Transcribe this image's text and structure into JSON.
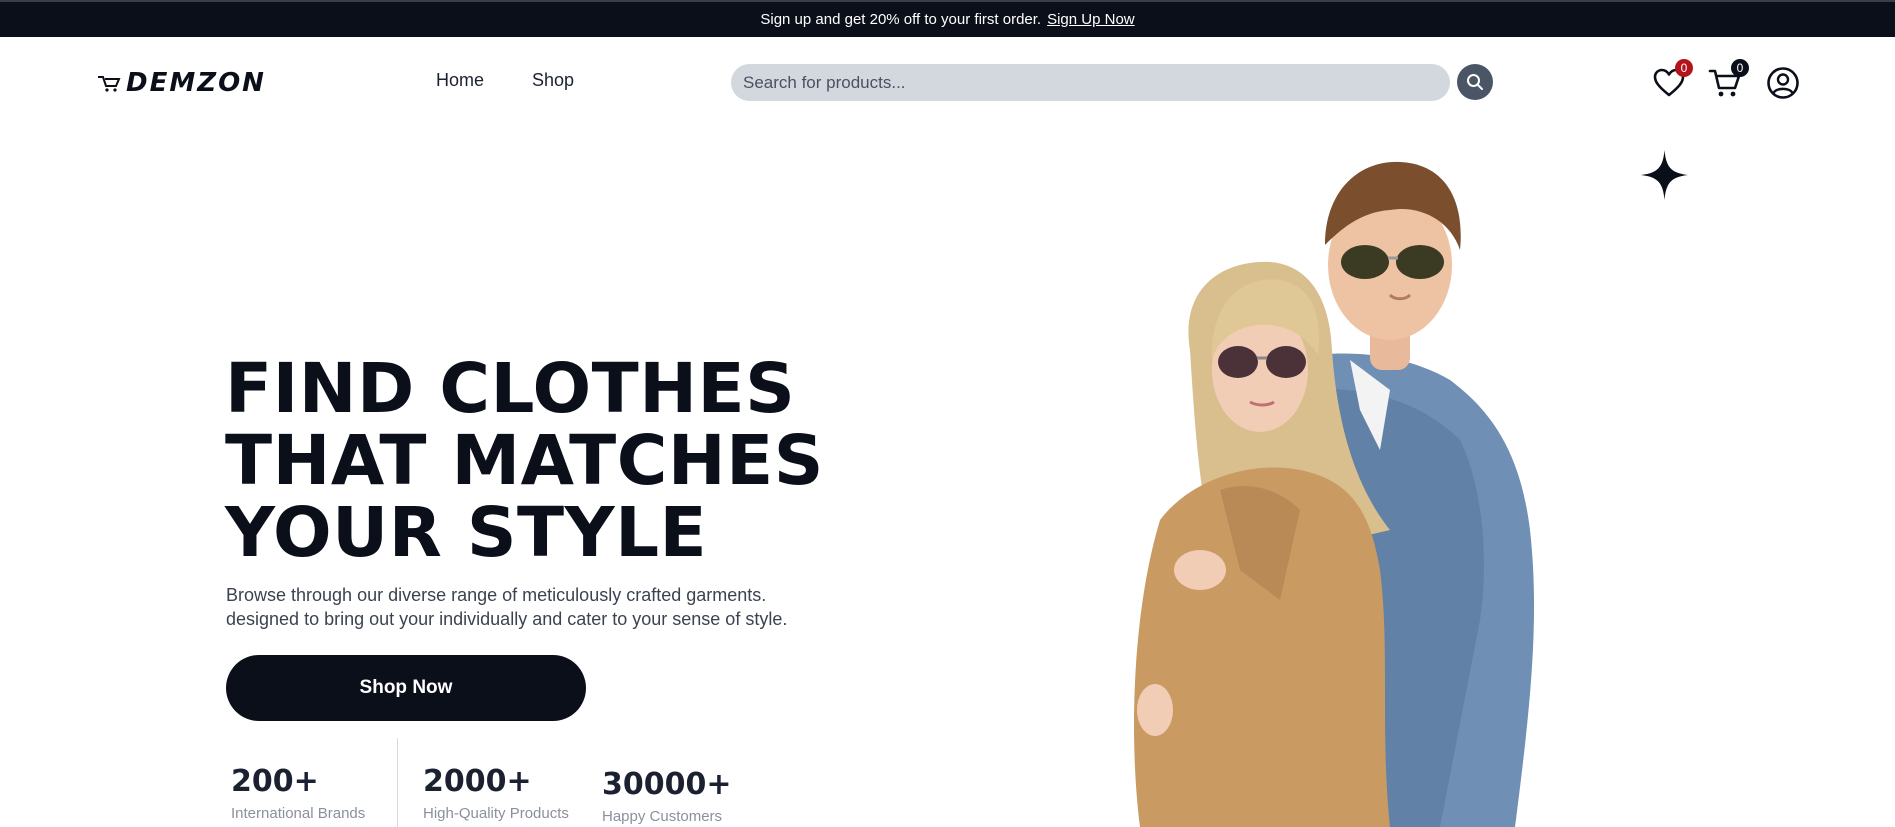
{
  "banner": {
    "text": "Sign up and get 20% off to your first order.",
    "link_label": "Sign Up Now"
  },
  "header": {
    "logo_text": "DEMZON",
    "nav": [
      {
        "label": "Home"
      },
      {
        "label": "Shop"
      }
    ],
    "search": {
      "placeholder": "Search for products..."
    },
    "wishlist_count": "0",
    "cart_count": "0"
  },
  "hero": {
    "title_lines": [
      "FIND CLOTHES",
      "THAT MATCHES",
      "YOUR STYLE"
    ],
    "description_lines": [
      "Browse through our diverse range of meticulously crafted garments.",
      "designed to bring out your individually and cater to your sense of style."
    ],
    "cta_label": "Shop Now",
    "stats": [
      {
        "value": "200+",
        "label": "International Brands"
      },
      {
        "value": "2000+",
        "label": "High-Quality Products"
      },
      {
        "value": "30000+",
        "label": "Happy Customers"
      }
    ]
  },
  "colors": {
    "dark": "#0b0f1a",
    "search_bg": "#d3d7de",
    "search_button": "#4a5566",
    "wishlist_badge": "#b3141b",
    "cart_badge": "#0b0f1a"
  },
  "icons": {
    "search": "search-icon",
    "wishlist": "heart-icon",
    "cart": "cart-icon",
    "account": "user-circle-icon",
    "decoration": "sparkle-icon"
  }
}
